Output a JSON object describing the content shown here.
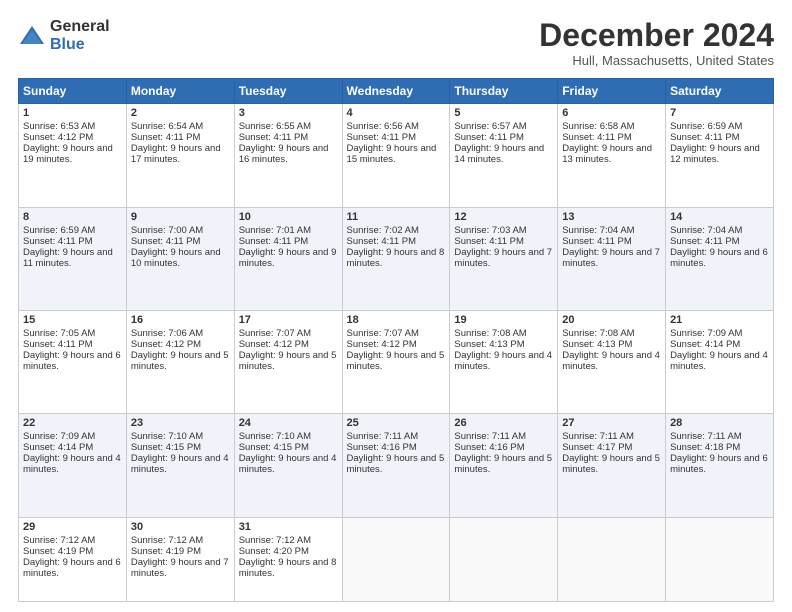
{
  "logo": {
    "general": "General",
    "blue": "Blue"
  },
  "title": "December 2024",
  "location": "Hull, Massachusetts, United States",
  "days_header": [
    "Sunday",
    "Monday",
    "Tuesday",
    "Wednesday",
    "Thursday",
    "Friday",
    "Saturday"
  ],
  "weeks": [
    [
      {
        "day": "1",
        "sunrise": "6:53 AM",
        "sunset": "4:12 PM",
        "daylight": "9 hours and 19 minutes."
      },
      {
        "day": "2",
        "sunrise": "6:54 AM",
        "sunset": "4:11 PM",
        "daylight": "9 hours and 17 minutes."
      },
      {
        "day": "3",
        "sunrise": "6:55 AM",
        "sunset": "4:11 PM",
        "daylight": "9 hours and 16 minutes."
      },
      {
        "day": "4",
        "sunrise": "6:56 AM",
        "sunset": "4:11 PM",
        "daylight": "9 hours and 15 minutes."
      },
      {
        "day": "5",
        "sunrise": "6:57 AM",
        "sunset": "4:11 PM",
        "daylight": "9 hours and 14 minutes."
      },
      {
        "day": "6",
        "sunrise": "6:58 AM",
        "sunset": "4:11 PM",
        "daylight": "9 hours and 13 minutes."
      },
      {
        "day": "7",
        "sunrise": "6:59 AM",
        "sunset": "4:11 PM",
        "daylight": "9 hours and 12 minutes."
      }
    ],
    [
      {
        "day": "8",
        "sunrise": "6:59 AM",
        "sunset": "4:11 PM",
        "daylight": "9 hours and 11 minutes."
      },
      {
        "day": "9",
        "sunrise": "7:00 AM",
        "sunset": "4:11 PM",
        "daylight": "9 hours and 10 minutes."
      },
      {
        "day": "10",
        "sunrise": "7:01 AM",
        "sunset": "4:11 PM",
        "daylight": "9 hours and 9 minutes."
      },
      {
        "day": "11",
        "sunrise": "7:02 AM",
        "sunset": "4:11 PM",
        "daylight": "9 hours and 8 minutes."
      },
      {
        "day": "12",
        "sunrise": "7:03 AM",
        "sunset": "4:11 PM",
        "daylight": "9 hours and 7 minutes."
      },
      {
        "day": "13",
        "sunrise": "7:04 AM",
        "sunset": "4:11 PM",
        "daylight": "9 hours and 7 minutes."
      },
      {
        "day": "14",
        "sunrise": "7:04 AM",
        "sunset": "4:11 PM",
        "daylight": "9 hours and 6 minutes."
      }
    ],
    [
      {
        "day": "15",
        "sunrise": "7:05 AM",
        "sunset": "4:11 PM",
        "daylight": "9 hours and 6 minutes."
      },
      {
        "day": "16",
        "sunrise": "7:06 AM",
        "sunset": "4:12 PM",
        "daylight": "9 hours and 5 minutes."
      },
      {
        "day": "17",
        "sunrise": "7:07 AM",
        "sunset": "4:12 PM",
        "daylight": "9 hours and 5 minutes."
      },
      {
        "day": "18",
        "sunrise": "7:07 AM",
        "sunset": "4:12 PM",
        "daylight": "9 hours and 5 minutes."
      },
      {
        "day": "19",
        "sunrise": "7:08 AM",
        "sunset": "4:13 PM",
        "daylight": "9 hours and 4 minutes."
      },
      {
        "day": "20",
        "sunrise": "7:08 AM",
        "sunset": "4:13 PM",
        "daylight": "9 hours and 4 minutes."
      },
      {
        "day": "21",
        "sunrise": "7:09 AM",
        "sunset": "4:14 PM",
        "daylight": "9 hours and 4 minutes."
      }
    ],
    [
      {
        "day": "22",
        "sunrise": "7:09 AM",
        "sunset": "4:14 PM",
        "daylight": "9 hours and 4 minutes."
      },
      {
        "day": "23",
        "sunrise": "7:10 AM",
        "sunset": "4:15 PM",
        "daylight": "9 hours and 4 minutes."
      },
      {
        "day": "24",
        "sunrise": "7:10 AM",
        "sunset": "4:15 PM",
        "daylight": "9 hours and 4 minutes."
      },
      {
        "day": "25",
        "sunrise": "7:11 AM",
        "sunset": "4:16 PM",
        "daylight": "9 hours and 5 minutes."
      },
      {
        "day": "26",
        "sunrise": "7:11 AM",
        "sunset": "4:16 PM",
        "daylight": "9 hours and 5 minutes."
      },
      {
        "day": "27",
        "sunrise": "7:11 AM",
        "sunset": "4:17 PM",
        "daylight": "9 hours and 5 minutes."
      },
      {
        "day": "28",
        "sunrise": "7:11 AM",
        "sunset": "4:18 PM",
        "daylight": "9 hours and 6 minutes."
      }
    ],
    [
      {
        "day": "29",
        "sunrise": "7:12 AM",
        "sunset": "4:19 PM",
        "daylight": "9 hours and 6 minutes."
      },
      {
        "day": "30",
        "sunrise": "7:12 AM",
        "sunset": "4:19 PM",
        "daylight": "9 hours and 7 minutes."
      },
      {
        "day": "31",
        "sunrise": "7:12 AM",
        "sunset": "4:20 PM",
        "daylight": "9 hours and 8 minutes."
      },
      null,
      null,
      null,
      null
    ]
  ],
  "labels": {
    "sunrise": "Sunrise:",
    "sunset": "Sunset:",
    "daylight": "Daylight:"
  }
}
